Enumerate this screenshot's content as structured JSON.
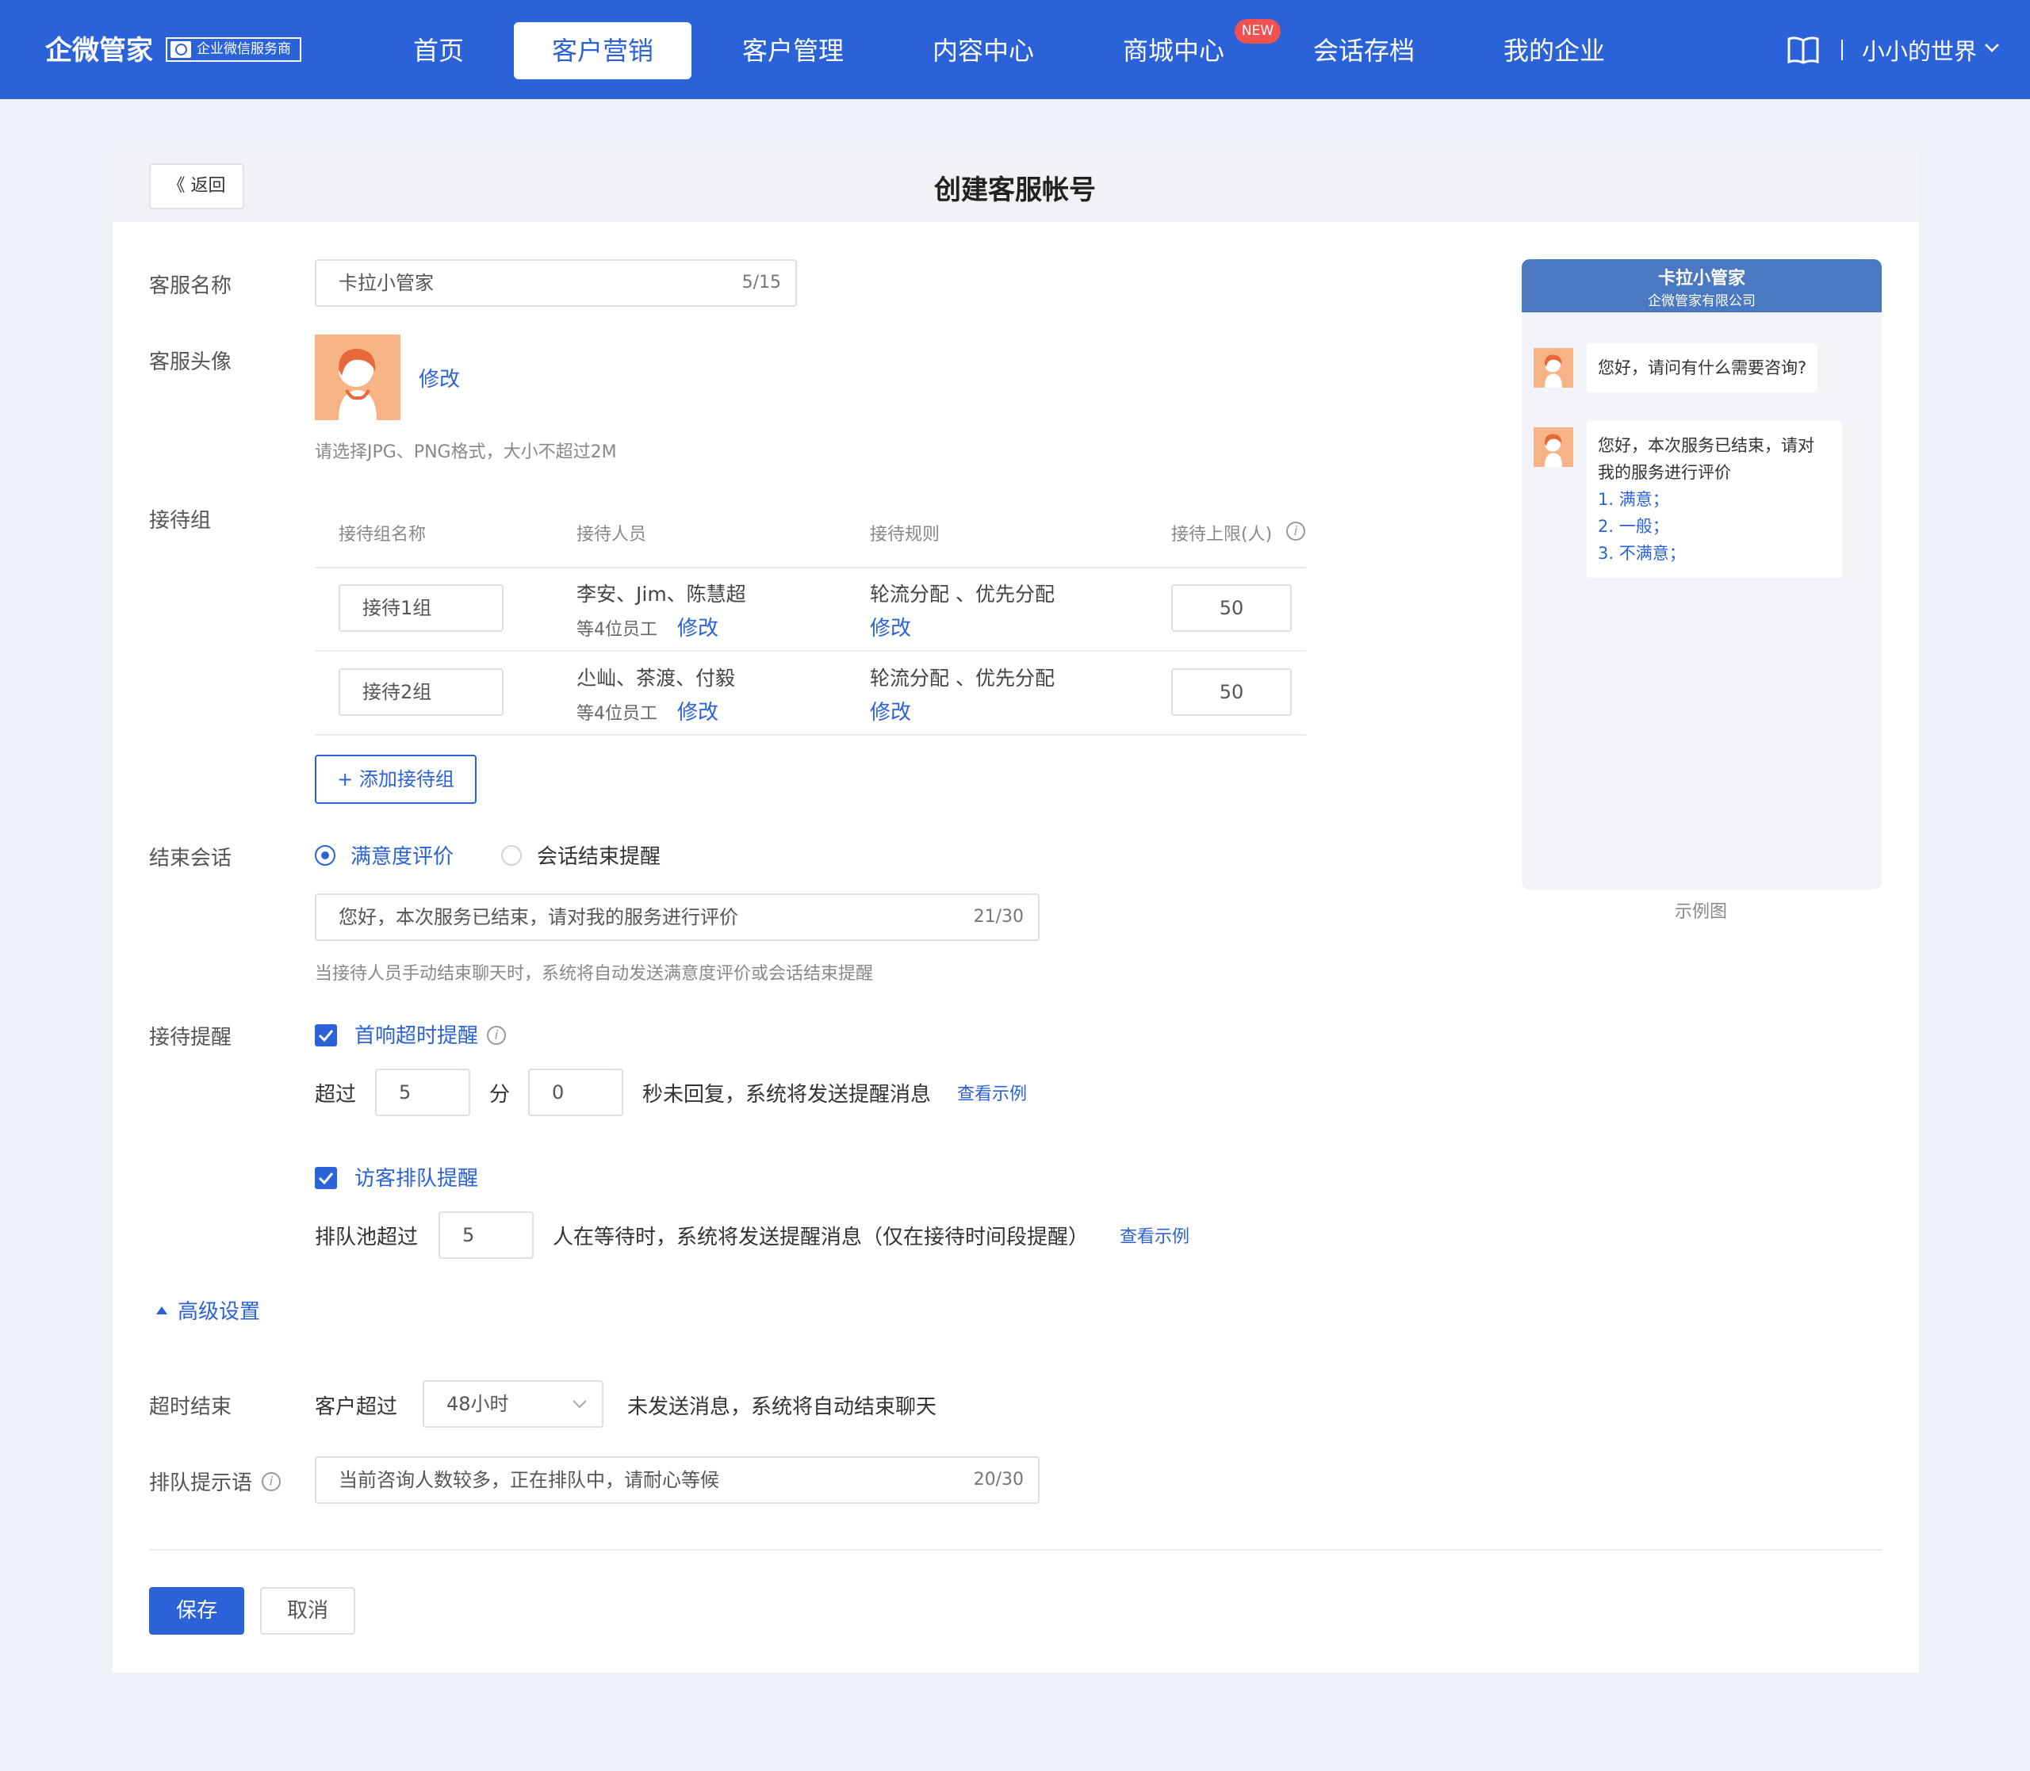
{
  "nav": {
    "brand": "企微管家",
    "brand_badge": "企业微信服务商",
    "items": [
      "首页",
      "客户营销",
      "客户管理",
      "内容中心",
      "商城中心",
      "会话存档",
      "我的企业"
    ],
    "active_index": 1,
    "new_badge": "NEW",
    "user": "小小的世界",
    "divider": "|"
  },
  "header": {
    "back": "《 返回",
    "title": "创建客服帐号"
  },
  "form": {
    "name_label": "客服名称",
    "name_value": "卡拉小管家",
    "name_counter": "5/15",
    "avatar_label": "客服头像",
    "avatar_edit": "修改",
    "avatar_hint": "请选择JPG、PNG格式，大小不超过2M",
    "group_label": "接待组",
    "table": {
      "headers": [
        "接待组名称",
        "接待人员",
        "接待规则",
        "接待上限(人)"
      ],
      "rows": [
        {
          "name": "接待1组",
          "staff": "李安、Jim、陈慧超",
          "staff_count": "等4位员工",
          "staff_edit": "修改",
          "rule": "轮流分配 、优先分配",
          "rule_edit": "修改",
          "limit": "50"
        },
        {
          "name": "接待2组",
          "staff": "尐屾、茶渡、付毅",
          "staff_count": "等4位员工",
          "staff_edit": "修改",
          "rule": "轮流分配 、优先分配",
          "rule_edit": "修改",
          "limit": "50"
        }
      ]
    },
    "add_group": "+ 添加接待组",
    "end_label": "结束会话",
    "end_option1": "满意度评价",
    "end_option2": "会话结束提醒",
    "end_value": "您好，本次服务已结束，请对我的服务进行评价",
    "end_counter": "21/30",
    "end_hint": "当接待人员手动结束聊天时，系统将自动发送满意度评价或会话结束提醒",
    "remind_label": "接待提醒",
    "first_resp": "首响超时提醒",
    "exceed": "超过",
    "minutes": "5",
    "min_unit": "分",
    "seconds": "0",
    "first_resp_tail": "秒未回复，系统将发送提醒消息",
    "view_example": "查看示例",
    "queue_remind": "访客排队提醒",
    "queue_prefix": "排队池超过",
    "queue_value": "5",
    "queue_tail": "人在等待时，系统将发送提醒消息（仅在接待时间段提醒）",
    "view_example2": "查看示例",
    "advanced": "高级设置",
    "timeout_label": "超时结束",
    "timeout_prefix": "客户超过",
    "timeout_value": "48小时",
    "timeout_tail": "未发送消息，系统将自动结束聊天",
    "queue_tip_label": "排队提示语",
    "queue_tip_value": "当前咨询人数较多，正在排队中，请耐心等候",
    "queue_tip_counter": "20/30",
    "save": "保存",
    "cancel": "取消"
  },
  "preview": {
    "title": "卡拉小管家",
    "subtitle": "企微管家有限公司",
    "msg1": "您好，请问有什么需要咨询?",
    "msg2_line1": "您好，本次服务已结束，请对",
    "msg2_line2": "我的服务进行评价",
    "opt1": "1. 满意；",
    "opt2": "2. 一般；",
    "opt3": "3. 不满意；",
    "caption": "示例图"
  },
  "colors": {
    "primary": "#2b62d8",
    "preview_header": "#4a78c1",
    "avatar_bg": "#f6b486",
    "new_badge": "#f05252"
  }
}
